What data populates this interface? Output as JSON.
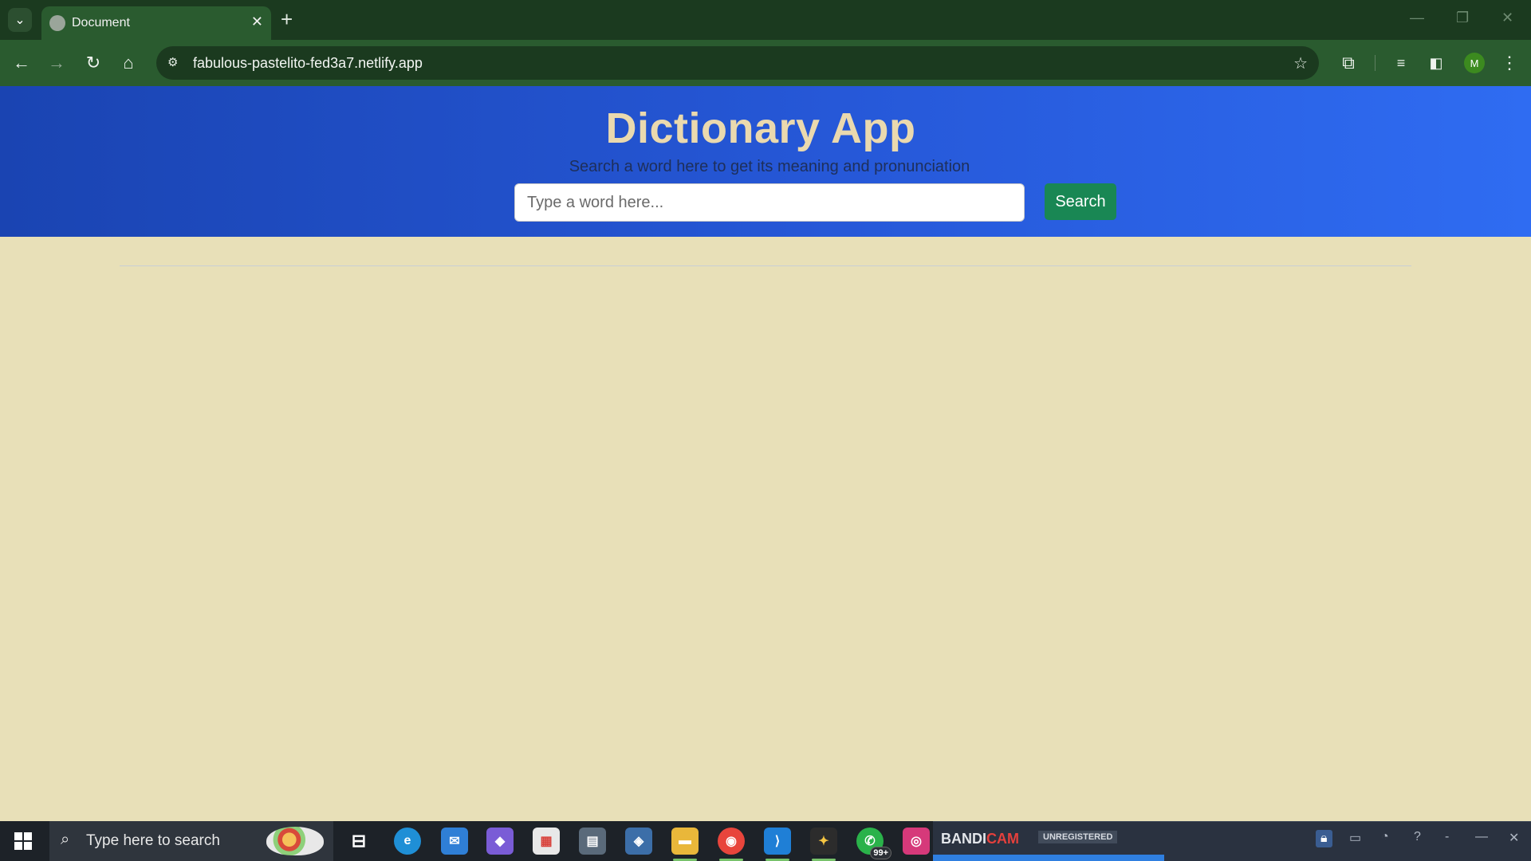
{
  "browser": {
    "tab_title": "Document",
    "tab_close": "✕",
    "new_tab": "+",
    "url": "fabulous-pastelito-fed3a7.netlify.app",
    "profile_initial": "M"
  },
  "app": {
    "title": "Dictionary App",
    "subtitle": "Search a word here to get its meaning and pronunciation",
    "search_placeholder": "Type a word here...",
    "search_button": "Search",
    "colors": {
      "header_start": "#1a44b2",
      "header_end": "#2f6cf2",
      "title": "#ead9ae",
      "page_background": "#e8e0b8",
      "button": "#198754"
    }
  },
  "taskbar": {
    "search_placeholder": "Type here to search",
    "whatsapp_badge": "99+"
  },
  "bandicam": {
    "brand_a": "BANDI",
    "brand_b": "CAM",
    "status": "UNREGISTERED"
  }
}
